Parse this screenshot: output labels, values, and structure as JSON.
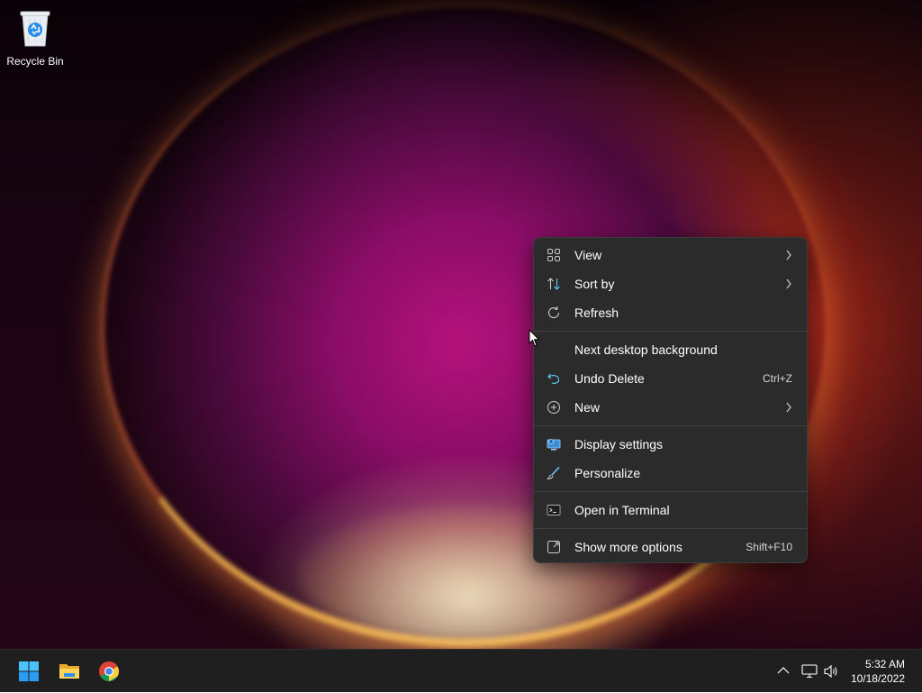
{
  "desktop": {
    "icons": [
      {
        "label": "Recycle Bin",
        "icon": "recycle-bin-icon"
      }
    ]
  },
  "context_menu": {
    "items": [
      {
        "label": "View",
        "icon": "view-grid-icon",
        "submenu": true
      },
      {
        "label": "Sort by",
        "icon": "sort-icon",
        "submenu": true
      },
      {
        "label": "Refresh",
        "icon": "refresh-icon"
      },
      {
        "label": "Next desktop background",
        "icon": ""
      },
      {
        "label": "Undo Delete",
        "icon": "undo-icon",
        "shortcut": "Ctrl+Z"
      },
      {
        "label": "New",
        "icon": "new-plus-icon",
        "submenu": true
      },
      {
        "label": "Display settings",
        "icon": "display-settings-icon"
      },
      {
        "label": "Personalize",
        "icon": "brush-icon"
      },
      {
        "label": "Open in Terminal",
        "icon": "terminal-icon"
      },
      {
        "label": "Show more options",
        "icon": "more-options-icon",
        "shortcut": "Shift+F10"
      }
    ]
  },
  "taskbar": {
    "apps": [
      {
        "name": "Start",
        "icon": "windows-start-icon"
      },
      {
        "name": "File Explorer",
        "icon": "file-explorer-icon"
      },
      {
        "name": "Google Chrome",
        "icon": "chrome-icon"
      }
    ],
    "tray_icons": [
      "chevron-up-icon",
      "network-icon",
      "volume-icon"
    ],
    "clock": {
      "time": "5:32 AM",
      "date": "10/18/2022"
    }
  },
  "colors": {
    "menu_bg": "#2b2b2b",
    "taskbar_bg": "#1f1f1f",
    "accent": "#60cdff"
  }
}
